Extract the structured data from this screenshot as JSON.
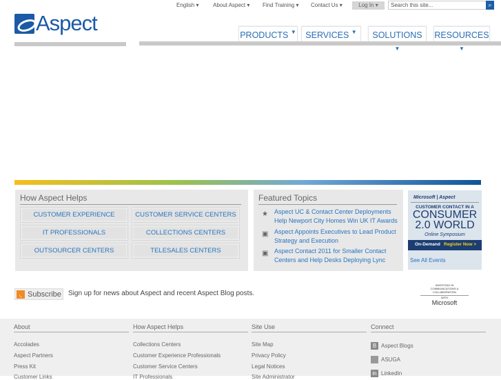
{
  "utility": {
    "english": "English ▾",
    "about": "About Aspect ▾",
    "training": "Find Training ▾",
    "contact": "Contact Us ▾",
    "login": "Log In ▾",
    "search_placeholder": "Search this site..."
  },
  "logo": {
    "text": "Aspect"
  },
  "nav": [
    {
      "label": "PRODUCTS"
    },
    {
      "label": "SERVICES"
    },
    {
      "label": "SOLUTIONS"
    },
    {
      "label": "RESOURCES"
    }
  ],
  "how": {
    "title": "How Aspect Helps",
    "buttons": [
      "CUSTOMER EXPERIENCE",
      "CUSTOMER SERVICE CENTERS",
      "IT PROFESSIONALS",
      "COLLECTIONS CENTERS",
      "OUTSOURCER CENTERS",
      "TELESALES CENTERS"
    ]
  },
  "featured": {
    "title": "Featured Topics",
    "items": [
      "Aspect UC & Contact Center Deployments Help Newport City Homes Win UK IT Awards",
      "Aspect Appoints Executives to Lead Product Strategy and Execution",
      "Aspect Contact 2011 for Smaller Contact Centers and Help Desks Deploying Lync"
    ]
  },
  "ad": {
    "brands": "Microsoft | Aspect",
    "line1": "CUSTOMER CONTACT IN A",
    "line2": "CONSUMER",
    "line3": "2.0 WORLD",
    "line4": "Online Symposium",
    "ondemand": "On-Demand",
    "register": "Register Now >",
    "see_all": "See All Events"
  },
  "subscribe": {
    "button": "Subscribe",
    "text": "Sign up for news about Aspect and recent Aspect Blog posts."
  },
  "ms_badge": {
    "line1": "INVESTING IN",
    "line2": "COMMUNICATIONS & COLLABORATION",
    "line3": "WITH",
    "line4": "Microsoft"
  },
  "footer": {
    "about": {
      "title": "About",
      "items": [
        "Accolades",
        "Aspect Partners",
        "Press Kit",
        "Customer Links"
      ]
    },
    "how": {
      "title": "How Aspect Helps",
      "items": [
        "Collections Centers",
        "Customer Experience Professionals",
        "Customer Service Centers",
        "IT Professionals"
      ]
    },
    "site": {
      "title": "Site Use",
      "items": [
        "Site Map",
        "Privacy Policy",
        "Legal Notices",
        "Site Administrator"
      ]
    },
    "connect": {
      "title": "Connect",
      "items": [
        "Aspect Blogs",
        "ASUGA",
        "LinkedIn"
      ]
    }
  }
}
